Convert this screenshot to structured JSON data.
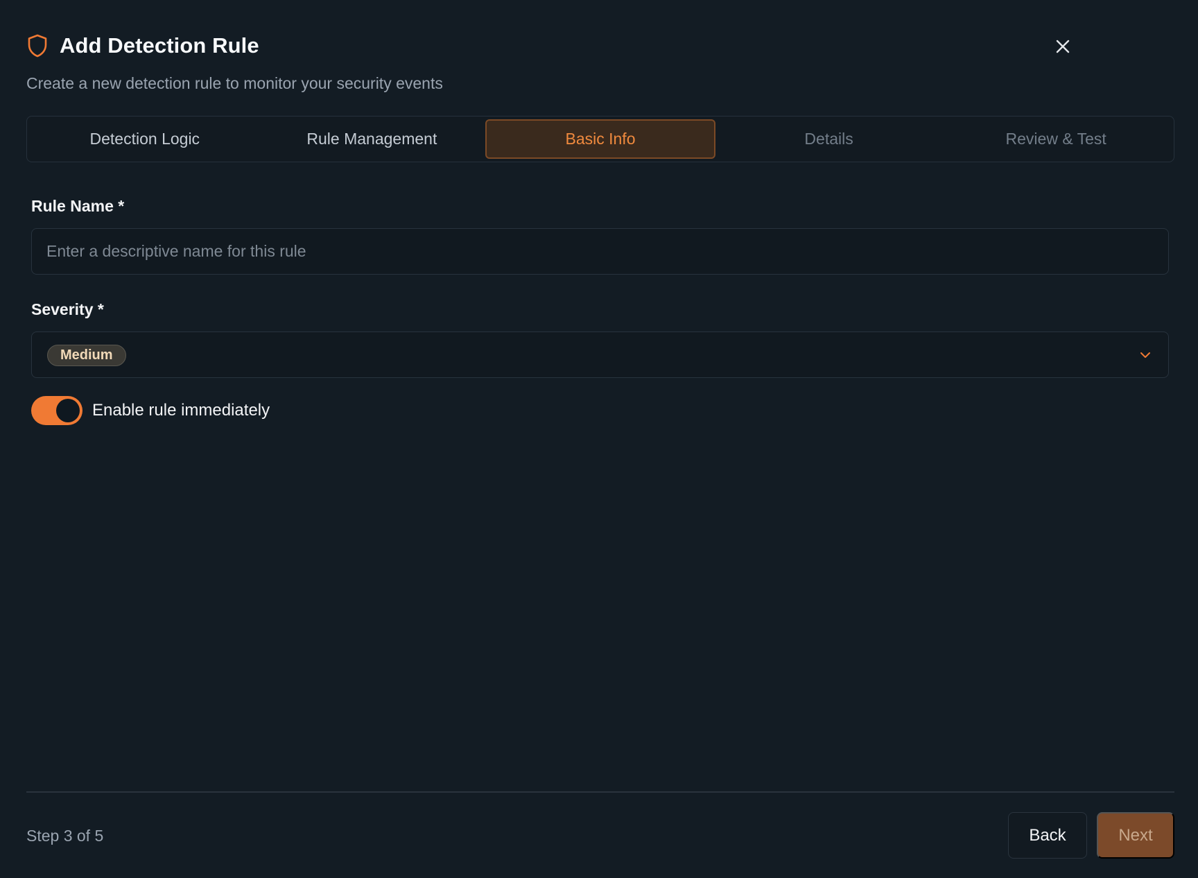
{
  "dialog": {
    "title": "Add Detection Rule",
    "subtitle": "Create a new detection rule to monitor your security events",
    "header_icon": "shield-icon",
    "close_icon": "close-icon"
  },
  "tabs": [
    {
      "label": "Detection Logic",
      "state": "completed"
    },
    {
      "label": "Rule Management",
      "state": "completed"
    },
    {
      "label": "Basic Info",
      "state": "active"
    },
    {
      "label": "Details",
      "state": "upcoming"
    },
    {
      "label": "Review & Test",
      "state": "upcoming"
    }
  ],
  "form": {
    "rule_name": {
      "label": "Rule Name *",
      "value": "",
      "placeholder": "Enter a descriptive name for this rule"
    },
    "severity": {
      "label": "Severity *",
      "selected": "Medium"
    },
    "enable_rule": {
      "label": "Enable rule immediately",
      "checked": true
    }
  },
  "footer": {
    "step_text": "Step 3 of 5",
    "back_label": "Back",
    "next_label": "Next"
  },
  "colors": {
    "accent": "#f07a34",
    "background": "#131c24",
    "active_tab_bg": "#3a2a1d"
  }
}
